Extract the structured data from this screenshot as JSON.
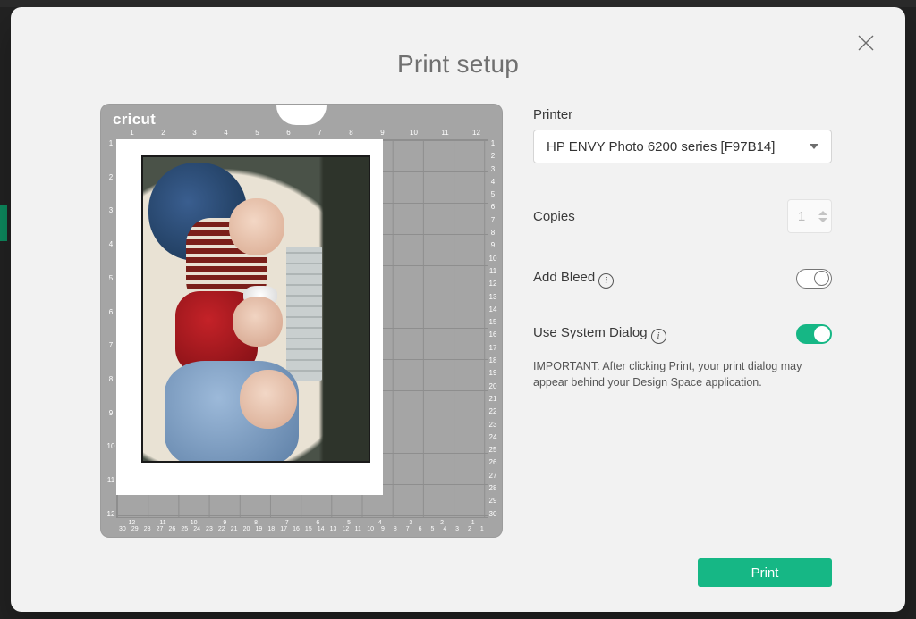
{
  "modal": {
    "title": "Print setup",
    "close_aria": "Close"
  },
  "mat": {
    "brand": "cricut",
    "top_ruler": [
      "1",
      "2",
      "3",
      "4",
      "5",
      "6",
      "7",
      "8",
      "9",
      "10",
      "11",
      "12"
    ],
    "left_ruler": [
      "1",
      "2",
      "3",
      "4",
      "5",
      "6",
      "7",
      "8",
      "9",
      "10",
      "11",
      "12"
    ],
    "right_ruler": [
      "1",
      "2",
      "3",
      "4",
      "5",
      "6",
      "7",
      "8",
      "9",
      "10",
      "11",
      "12",
      "13",
      "14",
      "15",
      "16",
      "17",
      "18",
      "19",
      "20",
      "21",
      "22",
      "23",
      "24",
      "25",
      "26",
      "27",
      "28",
      "29",
      "30"
    ],
    "bottom_ruler_in": [
      "12",
      "11",
      "10",
      "9",
      "8",
      "7",
      "6",
      "5",
      "4",
      "3",
      "2",
      "1"
    ],
    "bottom_ruler_cm": [
      "30",
      "29",
      "28",
      "27",
      "26",
      "25",
      "24",
      "23",
      "22",
      "21",
      "20",
      "19",
      "18",
      "17",
      "16",
      "15",
      "14",
      "13",
      "12",
      "11",
      "10",
      "9",
      "8",
      "7",
      "6",
      "5",
      "4",
      "3",
      "2",
      "1"
    ]
  },
  "panel": {
    "printer_label": "Printer",
    "printer_value": "HP ENVY Photo 6200 series [F97B14]",
    "copies_label": "Copies",
    "copies_value": "1",
    "bleed_label": "Add Bleed",
    "bleed_on": false,
    "system_label": "Use System Dialog",
    "system_on": true,
    "note": "IMPORTANT: After clicking Print, your print dialog may appear behind your Design Space application.",
    "print_button": "Print"
  }
}
